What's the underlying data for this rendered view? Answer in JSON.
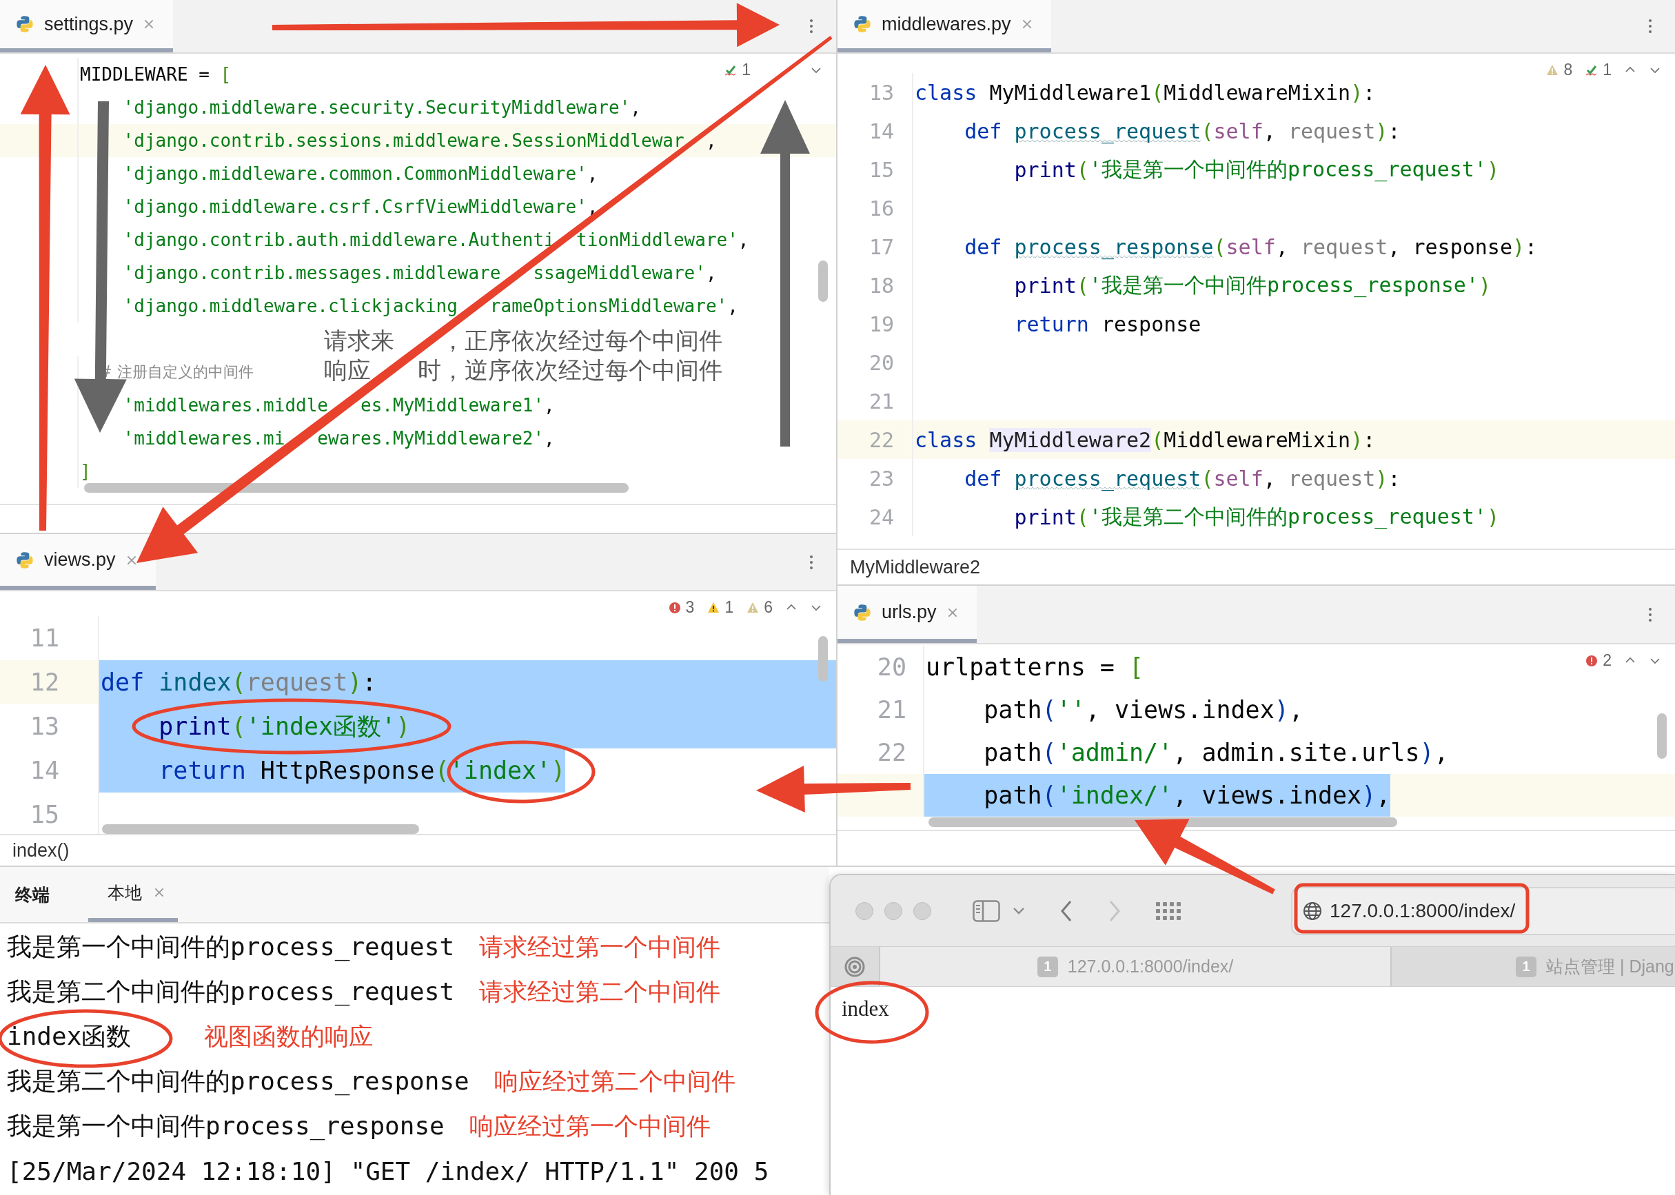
{
  "editors": [
    {
      "tab": {
        "name": "settings.py",
        "selected": true
      },
      "inspections": [
        {
          "kind": "typo",
          "count": "1"
        }
      ],
      "notes": [
        {
          "parts": [
            "请求来",
            "，正序依次经过每个中间件"
          ]
        },
        {
          "parts": [
            "响应",
            "时，逆序依次经过每个中间件"
          ]
        }
      ],
      "lines": [
        {
          "current": false,
          "tokens": [
            {
              "text": "MIDDLEWARE = ",
              "kind": "plain"
            },
            {
              "text": "[",
              "kind": "paren"
            }
          ]
        },
        {
          "current": false,
          "tokens": [
            {
              "text": "    'django.middleware.security.SecurityMiddleware'",
              "kind": "string"
            },
            {
              "text": ",",
              "kind": "plain"
            }
          ]
        },
        {
          "current": true,
          "tokens": [
            {
              "text": "    'django.contrib.sessions.middleware.SessionMiddlewar",
              "kind": "string"
            },
            {
              "text": "  ,",
              "kind": "plain"
            }
          ]
        },
        {
          "current": false,
          "tokens": [
            {
              "text": "    'django.middleware.common.CommonMiddleware'",
              "kind": "string"
            },
            {
              "text": ",",
              "kind": "plain"
            }
          ]
        },
        {
          "current": false,
          "tokens": [
            {
              "text": "    'django.middleware.csrf.CsrfViewMiddleware'",
              "kind": "string"
            },
            {
              "text": ",",
              "kind": "plain"
            }
          ]
        },
        {
          "current": false,
          "tokens": [
            {
              "text": "    'django.contrib.auth.middleware.Authenti  tionMiddleware'",
              "kind": "string"
            },
            {
              "text": ",",
              "kind": "plain"
            }
          ]
        },
        {
          "current": false,
          "tokens": [
            {
              "text": "    'django.contrib.messages.middleware   ssageMiddleware'",
              "kind": "string"
            },
            {
              "text": ",",
              "kind": "plain"
            }
          ]
        },
        {
          "current": false,
          "tokens": [
            {
              "text": "    'django.middleware.clickjacking   rameOptionsMiddleware'",
              "kind": "string"
            },
            {
              "text": ",",
              "kind": "plain"
            }
          ]
        },
        {
          "current": false,
          "blank_line_before": true,
          "tokens": [
            {
              "text": "    # 注册自定义的中间件",
              "kind": "comment"
            }
          ]
        },
        {
          "current": false,
          "tokens": [
            {
              "text": "    'middlewares.middle   es.MyMiddleware1'",
              "kind": "string"
            },
            {
              "text": ",",
              "kind": "plain"
            }
          ]
        },
        {
          "current": false,
          "tokens": [
            {
              "text": "    'middlewares.mi   ewares.MyMiddleware2'",
              "kind": "string"
            },
            {
              "text": ",",
              "kind": "plain"
            }
          ]
        },
        {
          "current": false,
          "tokens": [
            {
              "text": "]",
              "kind": "paren"
            }
          ]
        }
      ]
    },
    {
      "tab": {
        "name": "middlewares.py",
        "selected": true
      },
      "inspections": [
        {
          "kind": "weak",
          "count": "8"
        },
        {
          "kind": "typo",
          "count": "1"
        }
      ],
      "breadcrumb": "MyMiddleware2",
      "lines": [
        {
          "number": "13",
          "current": false,
          "tokens": [
            {
              "text": "class ",
              "kind": "keyword"
            },
            {
              "text": "MyMiddleware1",
              "kind": "plain"
            },
            {
              "text": "(",
              "kind": "paren"
            },
            {
              "text": "MiddlewareMixin",
              "kind": "plain"
            },
            {
              "text": ")",
              "kind": "paren"
            },
            {
              "text": ":",
              "kind": "plain"
            }
          ]
        },
        {
          "number": "14",
          "current": false,
          "tokens": [
            {
              "text": "    def ",
              "kind": "keyword"
            },
            {
              "text": "process_request",
              "kind": "method"
            },
            {
              "text": "(",
              "kind": "paren"
            },
            {
              "text": "self",
              "kind": "self"
            },
            {
              "text": ", ",
              "kind": "plain"
            },
            {
              "text": "request",
              "kind": "param"
            },
            {
              "text": ")",
              "kind": "paren"
            },
            {
              "text": ":",
              "kind": "plain"
            }
          ]
        },
        {
          "number": "15",
          "current": false,
          "tokens": [
            {
              "text": "        print",
              "kind": "builtin"
            },
            {
              "text": "(",
              "kind": "paren"
            },
            {
              "text": "'我是第一个中间件的process_request'",
              "kind": "string"
            },
            {
              "text": ")",
              "kind": "paren"
            }
          ]
        },
        {
          "number": "16",
          "current": false
        },
        {
          "number": "17",
          "current": false,
          "tokens": [
            {
              "text": "    def ",
              "kind": "keyword"
            },
            {
              "text": "process_response",
              "kind": "method"
            },
            {
              "text": "(",
              "kind": "paren"
            },
            {
              "text": "self",
              "kind": "self"
            },
            {
              "text": ", ",
              "kind": "plain"
            },
            {
              "text": "request",
              "kind": "param"
            },
            {
              "text": ", response",
              "kind": "plain"
            },
            {
              "text": ")",
              "kind": "paren"
            },
            {
              "text": ":",
              "kind": "plain"
            }
          ]
        },
        {
          "number": "18",
          "current": false,
          "tokens": [
            {
              "text": "        print",
              "kind": "builtin"
            },
            {
              "text": "(",
              "kind": "paren"
            },
            {
              "text": "'我是第一个中间件process_response'",
              "kind": "string"
            },
            {
              "text": ")",
              "kind": "paren"
            }
          ]
        },
        {
          "number": "19",
          "current": false,
          "tokens": [
            {
              "text": "        return",
              "kind": "keyword"
            },
            {
              "text": " response",
              "kind": "plain"
            }
          ]
        },
        {
          "number": "20",
          "current": false
        },
        {
          "number": "21",
          "current": false
        },
        {
          "number": "22",
          "current": true,
          "tokens": [
            {
              "text": "class ",
              "kind": "keyword"
            },
            {
              "text": "MyMiddleware2",
              "kind": "match"
            },
            {
              "text": "(",
              "kind": "paren"
            },
            {
              "text": "MiddlewareMixin",
              "kind": "plain"
            },
            {
              "text": ")",
              "kind": "paren"
            },
            {
              "text": ":",
              "kind": "plain"
            }
          ]
        },
        {
          "number": "23",
          "current": false,
          "tokens": [
            {
              "text": "    def ",
              "kind": "keyword"
            },
            {
              "text": "process_request",
              "kind": "method"
            },
            {
              "text": "(",
              "kind": "paren"
            },
            {
              "text": "self",
              "kind": "self"
            },
            {
              "text": ", ",
              "kind": "plain"
            },
            {
              "text": "request",
              "kind": "param"
            },
            {
              "text": ")",
              "kind": "paren"
            },
            {
              "text": ":",
              "kind": "plain"
            }
          ]
        },
        {
          "number": "24",
          "current": false,
          "tokens": [
            {
              "text": "        print",
              "kind": "builtin"
            },
            {
              "text": "(",
              "kind": "paren"
            },
            {
              "text": "'我是第二个中间件的process_request'",
              "kind": "string"
            },
            {
              "text": ")",
              "kind": "paren"
            }
          ]
        }
      ]
    },
    {
      "tab": {
        "name": "views.py",
        "selected": true
      },
      "inspections": [
        {
          "kind": "error",
          "count": "3"
        },
        {
          "kind": "warning",
          "count": "1"
        },
        {
          "kind": "weak",
          "count": "6"
        }
      ],
      "breadcrumb": "index()",
      "lines": [
        {
          "number": "11",
          "current": false
        },
        {
          "number": "12",
          "current": true,
          "selected": true,
          "tokens": [
            {
              "text": "def ",
              "kind": "keyword"
            },
            {
              "text": "index",
              "kind": "func"
            },
            {
              "text": "(",
              "kind": "paren"
            },
            {
              "text": "request",
              "kind": "param"
            },
            {
              "text": ")",
              "kind": "paren"
            },
            {
              "text": ":",
              "kind": "plain"
            }
          ]
        },
        {
          "number": "13",
          "current": false,
          "selected": true,
          "tokens": [
            {
              "text": "    print",
              "kind": "builtin"
            },
            {
              "text": "(",
              "kind": "paren"
            },
            {
              "text": "'index函数'",
              "kind": "string"
            },
            {
              "text": ")",
              "kind": "paren"
            }
          ]
        },
        {
          "number": "14",
          "current": false,
          "selected": true,
          "tokens": [
            {
              "text": "    return",
              "kind": "keyword"
            },
            {
              "text": " HttpResponse",
              "kind": "plain"
            },
            {
              "text": "(",
              "kind": "paren"
            },
            {
              "text": "'index'",
              "kind": "string"
            },
            {
              "text": ")",
              "kind": "paren"
            }
          ]
        },
        {
          "number": "15",
          "current": false
        }
      ]
    },
    {
      "tab": {
        "name": "urls.py",
        "selected": true
      },
      "inspections": [
        {
          "kind": "error",
          "count": "2"
        }
      ],
      "lines": [
        {
          "number": "20",
          "current": false,
          "selected": false,
          "tokens": [
            {
              "text": "urlpatterns = ",
              "kind": "plain"
            },
            {
              "text": "[",
              "kind": "paren"
            }
          ]
        },
        {
          "number": "21",
          "current": false,
          "selected": false,
          "tokens": [
            {
              "text": "    path",
              "kind": "plain"
            },
            {
              "text": "(",
              "kind": "paren2"
            },
            {
              "text": "''",
              "kind": "string"
            },
            {
              "text": ", views.index",
              "kind": "plain"
            },
            {
              "text": ")",
              "kind": "paren2"
            },
            {
              "text": ",",
              "kind": "plain"
            }
          ]
        },
        {
          "number": "22",
          "current": false,
          "selected": false,
          "tokens": [
            {
              "text": "    path",
              "kind": "plain"
            },
            {
              "text": "(",
              "kind": "paren2"
            },
            {
              "text": "'admin/'",
              "kind": "string"
            },
            {
              "text": ", admin.site.urls",
              "kind": "plain"
            },
            {
              "text": ")",
              "kind": "paren2"
            },
            {
              "text": ",",
              "kind": "plain"
            }
          ]
        },
        {
          "current": true,
          "selected": true,
          "tokens": [
            {
              "text": "    path",
              "kind": "plain"
            },
            {
              "text": "(",
              "kind": "paren2"
            },
            {
              "text": "'index/'",
              "kind": "string"
            },
            {
              "text": ", views.index",
              "kind": "plain"
            },
            {
              "text": ")",
              "kind": "paren2"
            },
            {
              "text": ",",
              "kind": "plain"
            }
          ]
        }
      ]
    }
  ],
  "terminal": {
    "title": "终端",
    "tabs": [
      {
        "label": "本地",
        "selected": true
      }
    ],
    "lines": [
      {
        "text": "我是第一个中间件的process_request",
        "note": "请求经过第一个中间件"
      },
      {
        "text": "我是第二个中间件的process_request",
        "note": "请求经过第二个中间件"
      },
      {
        "text": "index函数",
        "note": "视图函数的响应"
      },
      {
        "text": "我是第二个中间件的process_response",
        "note": "响应经过第二个中间件"
      },
      {
        "text": "我是第一个中间件process_response",
        "note": "响应经过第一个中间件"
      },
      {
        "text": "[25/Mar/2024 12:18:10] \"GET /index/ HTTP/1.1\" 200 5"
      }
    ]
  },
  "browser": {
    "nav": [
      {
        "kind": "back",
        "disabled": false
      },
      {
        "kind": "forward",
        "disabled": true
      }
    ],
    "address": "127.0.0.1:8000/index/",
    "tabs": [
      {
        "badge": "1",
        "title": "127.0.0.1:8000/index/",
        "selected": true
      },
      {
        "badge": "1",
        "title": "站点管理 | Djang",
        "selected": false
      }
    ],
    "content": "index"
  }
}
